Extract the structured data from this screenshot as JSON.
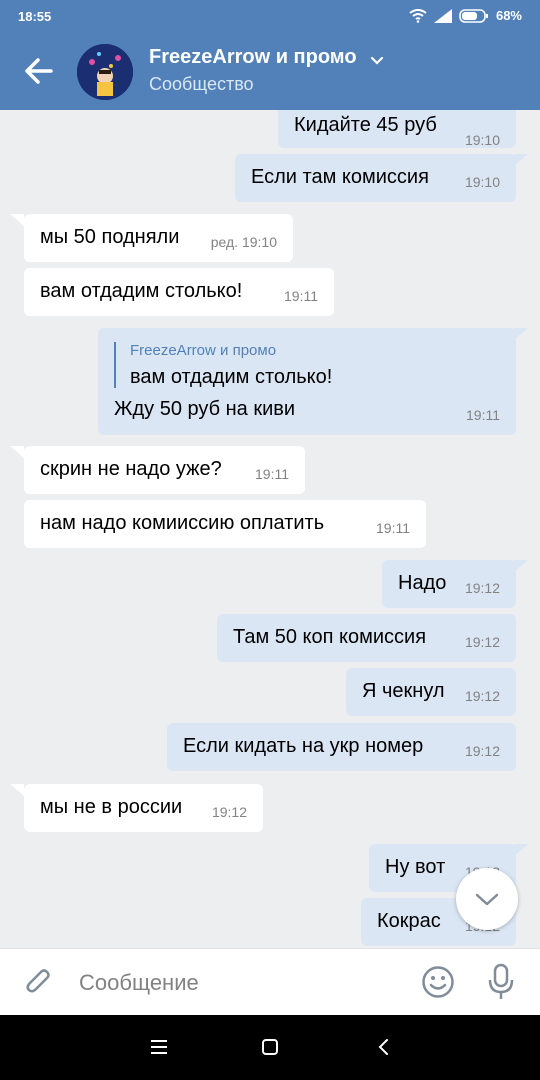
{
  "status": {
    "time": "18:55",
    "battery": "68%"
  },
  "header": {
    "title": "FreezeArrow и промо",
    "subtitle": "Сообщество"
  },
  "messages": [
    {
      "dir": "out",
      "text": "Кидайте 45 руб",
      "time": "19:10"
    },
    {
      "dir": "out",
      "text": "Если там комиссия",
      "time": "19:10"
    },
    {
      "dir": "in",
      "text": "мы 50 подняли",
      "time": "ред. 19:10"
    },
    {
      "dir": "in",
      "text": "вам отдадим столько!",
      "time": "19:11"
    },
    {
      "dir": "out",
      "reply_name": "FreezeArrow и промо",
      "reply_text": "вам отдадим столько!",
      "text": "Жду 50 руб на киви",
      "time": "19:11"
    },
    {
      "dir": "in",
      "text": "скрин не надо уже?",
      "time": "19:11"
    },
    {
      "dir": "in",
      "text": "нам надо комииссию оплатить",
      "time": "19:11"
    },
    {
      "dir": "out",
      "text": "Надо",
      "time": "19:12"
    },
    {
      "dir": "out",
      "text": "Там 50 коп комиссия",
      "time": "19:12"
    },
    {
      "dir": "out",
      "text": "Я чекнул",
      "time": "19:12"
    },
    {
      "dir": "out",
      "text": "Если кидать на укр номер",
      "time": "19:12"
    },
    {
      "dir": "in",
      "text": "мы не в россии",
      "time": "19:12"
    },
    {
      "dir": "out",
      "text": "Ну вот",
      "time": "19:12"
    },
    {
      "dir": "out",
      "text": "Кокрас",
      "time": "19:12"
    }
  ],
  "composer": {
    "placeholder": "Сообщение"
  },
  "icons": {
    "back": "arrow-left-icon",
    "wifi": "wifi-icon",
    "signal": "signal-icon",
    "battery": "battery-icon",
    "attach": "paperclip-icon",
    "emoji": "smile-icon",
    "mic": "microphone-icon",
    "scroll": "chevron-down-icon"
  },
  "colors": {
    "accent": "#5181b8",
    "bubble_out": "#dbe6f5",
    "bubble_in": "#ffffff",
    "background": "#edeef0"
  }
}
